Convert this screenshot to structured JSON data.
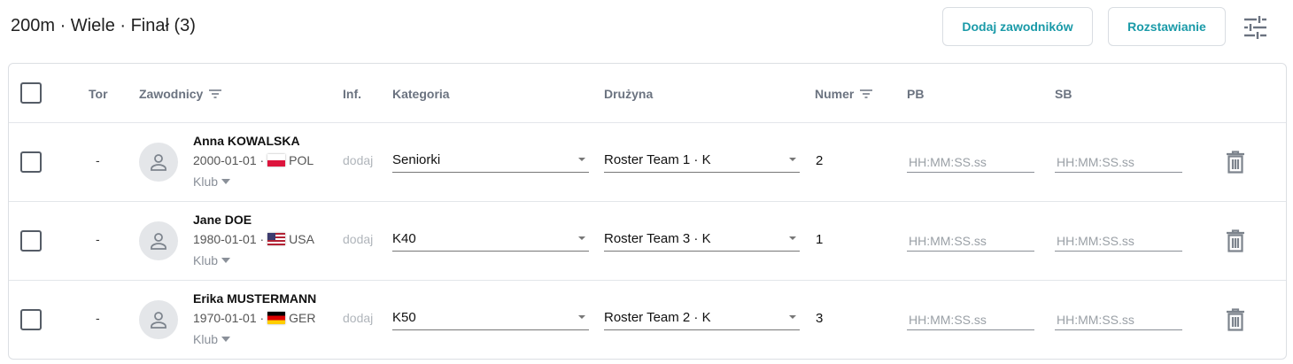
{
  "header": {
    "title": "200m · Wiele · Finał (3)",
    "add_button": "Dodaj zawodników",
    "seed_button": "Rozstawianie",
    "settings_icon": "tune-icon"
  },
  "table": {
    "columns": {
      "lane": "Tor",
      "athletes": "Zawodnicy",
      "info": "Inf.",
      "category": "Kategoria",
      "team": "Drużyna",
      "number": "Numer",
      "pb": "PB",
      "sb": "SB"
    },
    "rows": [
      {
        "lane": "-",
        "name": "Anna KOWALSKA",
        "birth": "2000-01-01 ·",
        "country": "POL",
        "club": "Klub",
        "info": "dodaj",
        "category": "Seniorki",
        "team": "Roster Team 1 · K",
        "number": "2",
        "pb_placeholder": "HH:MM:SS.ss",
        "sb_placeholder": "HH:MM:SS.ss"
      },
      {
        "lane": "-",
        "name": "Jane DOE",
        "birth": "1980-01-01 ·",
        "country": "USA",
        "club": "Klub",
        "info": "dodaj",
        "category": "K40",
        "team": "Roster Team 3 · K",
        "number": "1",
        "pb_placeholder": "HH:MM:SS.ss",
        "sb_placeholder": "HH:MM:SS.ss"
      },
      {
        "lane": "-",
        "name": "Erika MUSTERMANN",
        "birth": "1970-01-01 ·",
        "country": "GER",
        "club": "Klub",
        "info": "dodaj",
        "category": "K50",
        "team": "Roster Team 2 · K",
        "number": "3",
        "pb_placeholder": "HH:MM:SS.ss",
        "sb_placeholder": "HH:MM:SS.ss"
      }
    ]
  },
  "colors": {
    "accent": "#1a9aa8",
    "header_text": "#6b7380",
    "border": "#dcdfe3"
  }
}
